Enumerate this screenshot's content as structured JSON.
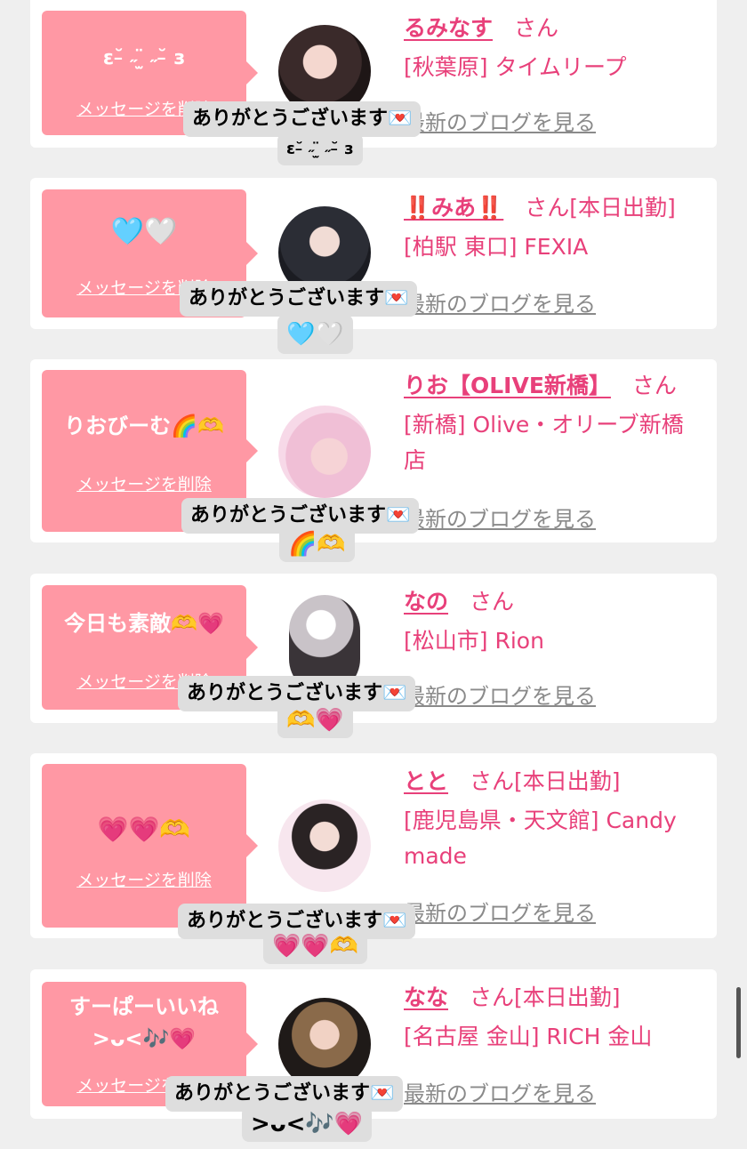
{
  "delete_label": "メッセージを削除",
  "blog_label": "最新のブログを見る",
  "san": "さん",
  "tooltip_thanks": "ありがとうございます💌",
  "cards": [
    {
      "message": "ε˘̵ ˶ ̫̈ ˶˘̵ з",
      "name": "るみなす",
      "today": "",
      "shop": "[秋葉原] タイムリープ",
      "reply": "ε˘̵ ˶ ̫̈ ˶˘̵ з"
    },
    {
      "message": "🩵🤍",
      "name": "‼️みあ‼️",
      "today": "[本日出勤]",
      "shop": "[柏駅 東口] FEXIA",
      "reply": "🩵🤍"
    },
    {
      "message": "りおびーむ🌈🫶",
      "name": "りお【OLIVE新橋】",
      "today": "",
      "shop": "[新橋] Olive・オリーブ新橋店",
      "reply": "🌈🫶"
    },
    {
      "message": "今日も素敵🫶💗",
      "name": "なの",
      "today": "",
      "shop": "[松山市] Rion",
      "reply": "🫶💗"
    },
    {
      "message": "💗💗🫶",
      "name": "とと",
      "today": "[本日出勤]",
      "shop": "[鹿児島県・天文館] Candy made",
      "reply": "💗💗🫶"
    },
    {
      "message": "すーぱーいいね\n>ᴗ<🎶💗",
      "name": "なな",
      "today": "[本日出勤]",
      "shop": "[名古屋 金山] RICH 金山",
      "reply": ">ᴗ<🎶💗"
    }
  ],
  "colors": {
    "bubble": "#ff98a4",
    "accent": "#e8407a",
    "background": "#efefef"
  }
}
